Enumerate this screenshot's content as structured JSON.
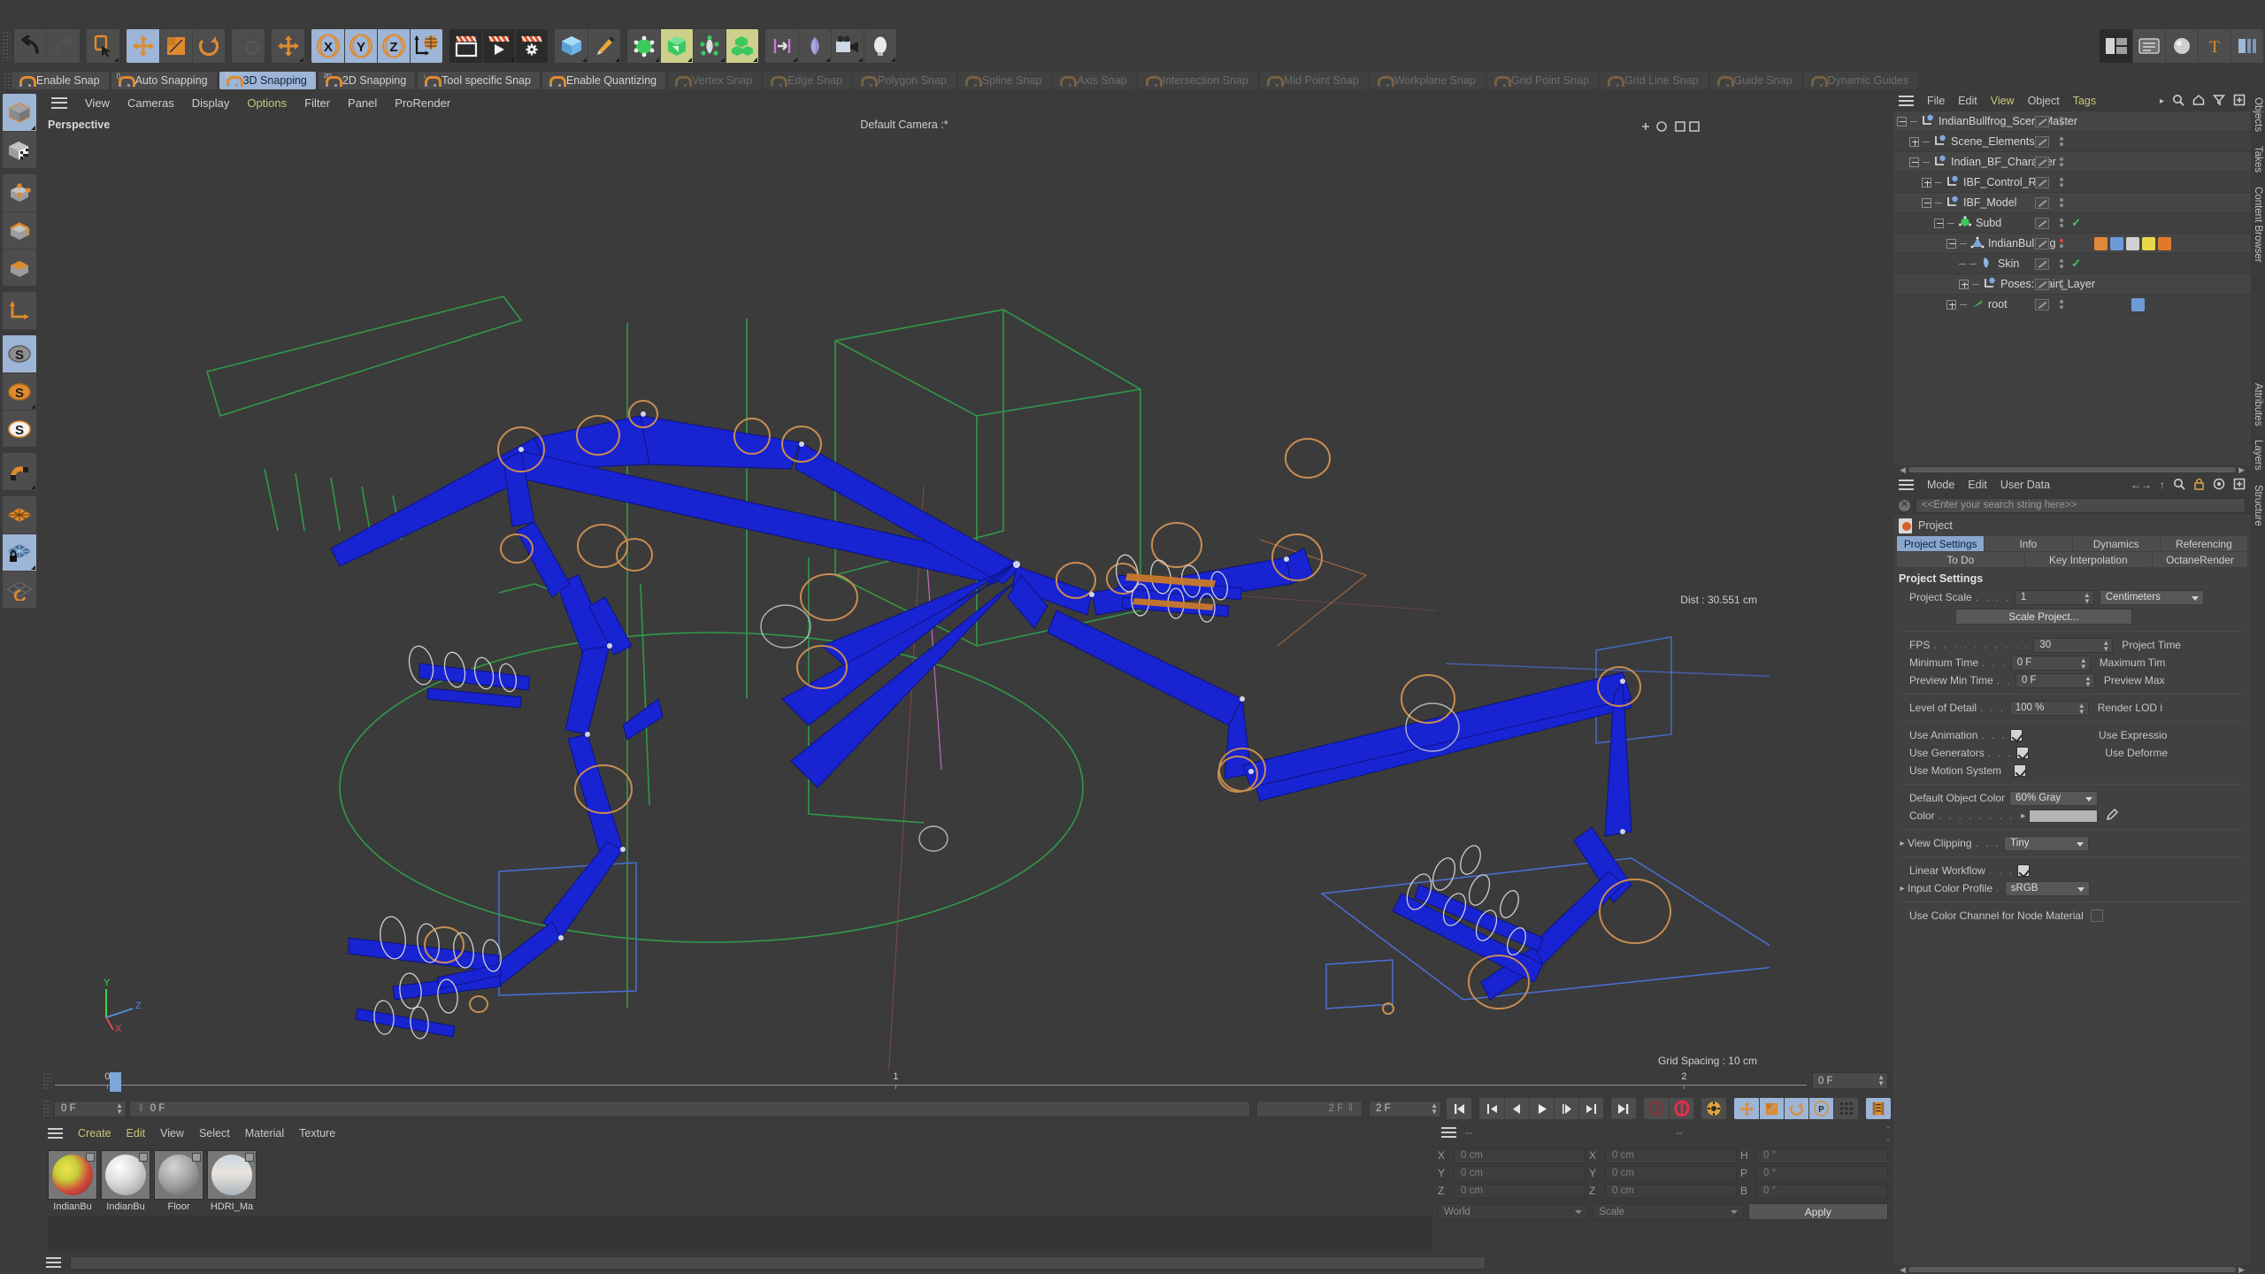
{
  "app": {
    "title": "Cinema 4D"
  },
  "main_toolbar": {
    "groups": [
      {
        "name": "history",
        "buttons": [
          {
            "id": "undo",
            "icon": "undo-arrow-icon",
            "state": "normal"
          },
          {
            "id": "redo",
            "icon": "redo-arrow-icon",
            "state": "disabled"
          }
        ]
      },
      {
        "name": "selection",
        "buttons": [
          {
            "id": "live-selection",
            "icon": "live-selection-icon",
            "state": "normal"
          }
        ]
      },
      {
        "name": "transform",
        "buttons": [
          {
            "id": "move",
            "icon": "move-icon",
            "state": "active"
          },
          {
            "id": "scale",
            "icon": "scale-icon",
            "state": "normal"
          },
          {
            "id": "rotate",
            "icon": "rotate-icon",
            "state": "normal"
          }
        ]
      },
      {
        "name": "psr",
        "buttons": [
          {
            "id": "psr-lock",
            "icon": "psr-rotate-icon",
            "state": "disabled"
          }
        ]
      },
      {
        "name": "world-move",
        "buttons": [
          {
            "id": "world-move",
            "icon": "move-icon",
            "state": "normal"
          }
        ]
      },
      {
        "name": "axes",
        "buttons": [
          {
            "id": "axis-x",
            "icon": "axis-x-icon",
            "state": "active",
            "label": "X"
          },
          {
            "id": "axis-y",
            "icon": "axis-y-icon",
            "state": "active",
            "label": "Y"
          },
          {
            "id": "axis-z",
            "icon": "axis-z-icon",
            "state": "active",
            "label": "Z"
          },
          {
            "id": "world-coordinates",
            "icon": "globe-axis-icon",
            "state": "active"
          }
        ]
      },
      {
        "name": "render",
        "buttons": [
          {
            "id": "render-view",
            "icon": "render-view-icon",
            "state": "dark"
          },
          {
            "id": "render-to-picture-viewer",
            "icon": "render-picture-viewer-icon",
            "state": "dark"
          },
          {
            "id": "render-settings",
            "icon": "render-settings-icon",
            "state": "dark"
          }
        ]
      },
      {
        "name": "primitives",
        "buttons": [
          {
            "id": "cube-primitive",
            "icon": "cube-icon",
            "state": "normal"
          },
          {
            "id": "pen-spline",
            "icon": "pen-icon",
            "state": "normal"
          }
        ]
      },
      {
        "name": "generators",
        "buttons": [
          {
            "id": "generators",
            "icon": "generator-icon",
            "state": "normal"
          },
          {
            "id": "array",
            "icon": "array-green-icon",
            "state": "olive"
          },
          {
            "id": "deformers",
            "icon": "deformer-icon",
            "state": "normal"
          },
          {
            "id": "mograph",
            "icon": "mograph-cubes-icon",
            "state": "olive"
          }
        ]
      },
      {
        "name": "misc",
        "buttons": [
          {
            "id": "scene-nodes",
            "icon": "scene-nodes-icon",
            "state": "normal"
          },
          {
            "id": "field",
            "icon": "field-icon",
            "state": "normal"
          },
          {
            "id": "camera",
            "icon": "camera-icon",
            "state": "normal"
          },
          {
            "id": "light",
            "icon": "light-bulb-icon",
            "state": "normal"
          }
        ]
      },
      {
        "name": "layout-right",
        "buttons": [
          {
            "id": "layout-switch",
            "icon": "layout-icon",
            "state": "dark"
          },
          {
            "id": "content-browser",
            "icon": "browser-icon",
            "state": "normal"
          },
          {
            "id": "material-sphere",
            "icon": "material-sphere-icon",
            "state": "normal"
          },
          {
            "id": "text-tool",
            "icon": "text-tool-icon",
            "state": "normal"
          },
          {
            "id": "more-tools",
            "icon": "more-tools-icon",
            "state": "normal"
          }
        ]
      }
    ]
  },
  "snap_bar": {
    "items": [
      {
        "label": "Enable Snap",
        "state": "on"
      },
      {
        "label": "Auto Snapping",
        "state": "on",
        "sup": "()"
      },
      {
        "label": "3D Snapping",
        "state": "selected",
        "sup": "3D"
      },
      {
        "label": "2D Snapping",
        "state": "on",
        "sup": "2D"
      },
      {
        "label": "Tool specific Snap",
        "state": "on",
        "sup": "↓"
      },
      {
        "label": "Enable Quantizing",
        "state": "on",
        "icon": "quantize-icon"
      },
      {
        "label": "Vertex Snap",
        "state": "off"
      },
      {
        "label": "Edge Snap",
        "state": "off"
      },
      {
        "label": "Polygon Snap",
        "state": "off"
      },
      {
        "label": "Spline Snap",
        "state": "off"
      },
      {
        "label": "Axis Snap",
        "state": "off"
      },
      {
        "label": "Intersection Snap",
        "state": "off"
      },
      {
        "label": "Mid Point Snap",
        "state": "off"
      },
      {
        "label": "Workplane Snap",
        "state": "off"
      },
      {
        "label": "Grid Point Snap",
        "state": "off"
      },
      {
        "label": "Grid Line Snap",
        "state": "off"
      },
      {
        "label": "Guide Snap",
        "state": "off"
      },
      {
        "label": "Dynamic Guides",
        "state": "off"
      }
    ]
  },
  "left_toolbar": {
    "groups": [
      {
        "buttons": [
          {
            "id": "model-mode",
            "icon": "model-cube-icon",
            "state": "active"
          },
          {
            "id": "texture-mode",
            "icon": "texture-cube-icon",
            "state": "normal"
          }
        ]
      },
      {
        "buttons": [
          {
            "id": "points-mode",
            "icon": "points-cube-icon",
            "state": "normal"
          },
          {
            "id": "edges-mode",
            "icon": "edges-cube-icon",
            "state": "normal"
          },
          {
            "id": "polygons-mode",
            "icon": "polygons-cube-icon",
            "state": "normal"
          }
        ]
      },
      {
        "buttons": [
          {
            "id": "object-axis-mode",
            "icon": "axis-corner-icon",
            "state": "normal"
          }
        ]
      },
      {
        "buttons": [
          {
            "id": "enable-axis",
            "icon": "s-grey-icon",
            "state": "active"
          },
          {
            "id": "soft-selection",
            "icon": "s-orange-icon",
            "state": "normal"
          },
          {
            "id": "soft-selection-2",
            "icon": "s-white-icon",
            "state": "normal"
          }
        ]
      },
      {
        "buttons": [
          {
            "id": "magnet-tool",
            "icon": "magnet-icon",
            "state": "normal"
          }
        ]
      },
      {
        "buttons": [
          {
            "id": "workplane",
            "icon": "workplane-icon",
            "state": "normal"
          },
          {
            "id": "lock-workplane",
            "icon": "workplane-lock-icon",
            "state": "active"
          },
          {
            "id": "align-workplane",
            "icon": "workplane-rotate-icon",
            "state": "normal"
          }
        ]
      }
    ]
  },
  "viewport": {
    "menu": [
      {
        "label": "View",
        "highlight": false
      },
      {
        "label": "Cameras",
        "highlight": false
      },
      {
        "label": "Display",
        "highlight": false
      },
      {
        "label": "Options",
        "highlight": true
      },
      {
        "label": "Filter",
        "highlight": false
      },
      {
        "label": "Panel",
        "highlight": false
      },
      {
        "label": "ProRender",
        "highlight": false
      }
    ],
    "label": "Perspective",
    "camera": "Default Camera :*",
    "distance": "Dist : 30.551 cm",
    "grid_spacing": "Grid Spacing : 10 cm",
    "axis_labels": {
      "x": "X",
      "y": "Y",
      "z": "Z"
    }
  },
  "object_manager": {
    "menu": [
      {
        "label": "File",
        "highlight": false
      },
      {
        "label": "Edit",
        "highlight": false
      },
      {
        "label": "View",
        "highlight": true
      },
      {
        "label": "Object",
        "highlight": false
      },
      {
        "label": "Tags",
        "highlight": true
      }
    ],
    "icons": [
      "search-icon",
      "home-icon",
      "filter-icon",
      "add-icon"
    ],
    "rows": [
      {
        "name": "IndianBullfrog_SceneMaster",
        "depth": 0,
        "expander": "minus",
        "icon": "null-object-icon",
        "tick": false,
        "tags": []
      },
      {
        "name": "Scene_Elements",
        "depth": 1,
        "expander": "plus",
        "icon": "null-object-icon",
        "tick": false,
        "tags": []
      },
      {
        "name": "Indian_BF_Character",
        "depth": 1,
        "expander": "minus",
        "icon": "null-object-icon",
        "tick": false,
        "tags": []
      },
      {
        "name": "IBF_Control_Rig",
        "depth": 2,
        "expander": "plus",
        "icon": "null-object-icon",
        "tick": false,
        "tags": []
      },
      {
        "name": "IBF_Model",
        "depth": 2,
        "expander": "minus",
        "icon": "null-object-icon",
        "tick": false,
        "tags": []
      },
      {
        "name": "Subd",
        "depth": 3,
        "expander": "minus",
        "icon": "subdivision-icon",
        "tick": true,
        "tags": []
      },
      {
        "name": "IndianBullfrog",
        "depth": 4,
        "expander": "minus",
        "icon": "polygon-object-icon",
        "tick": false,
        "dot": "red",
        "tags": [
          "point-cache-tag",
          "joint-tag",
          "material-grey-tag",
          "material-color-tag",
          "orange-tag"
        ]
      },
      {
        "name": "Skin",
        "depth": 5,
        "expander": "none",
        "icon": "skin-deformer-icon",
        "tick": true,
        "tags": []
      },
      {
        "name": "Poses: Main_Layer",
        "depth": 5,
        "expander": "plus",
        "icon": "null-object-icon",
        "tick": false,
        "tags": []
      },
      {
        "name": "root",
        "depth": 4,
        "expander": "plus",
        "icon": "joint-icon",
        "tick": false,
        "tags": [
          "joint-psr-tag"
        ]
      }
    ]
  },
  "attributes": {
    "menu": [
      {
        "label": "Mode",
        "highlight": false
      },
      {
        "label": "Edit",
        "highlight": false
      },
      {
        "label": "User Data",
        "highlight": false
      }
    ],
    "search_placeholder": "<<Enter your search string here>>",
    "object_name": "Project",
    "tabs": [
      {
        "label": "Project Settings",
        "selected": true
      },
      {
        "label": "Info",
        "selected": false
      },
      {
        "label": "Dynamics",
        "selected": false
      },
      {
        "label": "Referencing",
        "selected": false
      },
      {
        "label": "To Do",
        "selected": false
      },
      {
        "label": "Key Interpolation",
        "selected": false
      },
      {
        "label": "OctaneRender",
        "selected": false
      }
    ],
    "section_title": "Project Settings",
    "fields": {
      "project_scale_label": "Project Scale",
      "project_scale_value": "1",
      "project_scale_unit": "Centimeters",
      "scale_project_button": "Scale Project...",
      "fps_label": "FPS",
      "fps_value": "30",
      "project_time_label": "Project Time",
      "minimum_time_label": "Minimum Time",
      "minimum_time_value": "0 F",
      "maximum_time_label": "Maximum Tim",
      "preview_min_label": "Preview Min Time",
      "preview_min_value": "0 F",
      "preview_max_label": "Preview Max",
      "lod_label": "Level of Detail",
      "lod_value": "100 %",
      "render_lod_label": "Render LOD i",
      "use_animation_label": "Use Animation",
      "use_animation_checked": true,
      "use_expressions_label": "Use Expressio",
      "use_generators_label": "Use Generators",
      "use_generators_checked": true,
      "use_deformers_label": "Use Deforme",
      "use_motion_label": "Use Motion System",
      "use_motion_checked": true,
      "default_object_color_label": "Default Object Color",
      "default_object_color_value": "60% Gray",
      "color_label": "Color",
      "view_clipping_label": "View Clipping",
      "view_clipping_value": "Tiny",
      "linear_workflow_label": "Linear Workflow",
      "linear_workflow_checked": true,
      "input_color_profile_label": "Input Color Profile",
      "input_color_profile_value": "sRGB",
      "node_material_label": "Use Color Channel for Node Material",
      "node_material_checked": false
    }
  },
  "right_vtabs_top": [
    "Objects",
    "Takes",
    "Content Browser"
  ],
  "right_vtabs_bottom": [
    "Attributes",
    "Layers",
    "Structure"
  ],
  "timeline": {
    "start_marker": "0",
    "ticks": [
      {
        "label": "0",
        "pct": 3
      },
      {
        "label": "1",
        "pct": 48
      },
      {
        "label": "2",
        "pct": 93
      }
    ],
    "end_field": "0 F",
    "current_frame": "0 F",
    "current_frame_secondary": "0 F",
    "range_end": "2 F",
    "range_end_field": "2 F",
    "transport": [
      {
        "id": "go-to-start",
        "icon": "skip-start-icon"
      },
      {
        "id": "previous-keyframe",
        "icon": "prev-key-icon"
      },
      {
        "id": "step-back",
        "icon": "step-back-icon"
      },
      {
        "id": "play",
        "icon": "play-icon"
      },
      {
        "id": "step-forward",
        "icon": "step-forward-icon"
      },
      {
        "id": "next-keyframe",
        "icon": "next-key-icon"
      },
      {
        "id": "go-to-end",
        "icon": "skip-end-icon"
      }
    ],
    "record_buttons": [
      {
        "id": "autokey",
        "icon": "autokey-icon",
        "state": "dim"
      },
      {
        "id": "record",
        "icon": "record-icon",
        "state": "on"
      },
      {
        "id": "keyframe-selection",
        "icon": "key-selection-icon",
        "state": "on"
      }
    ],
    "key_toggles": [
      {
        "id": "key-position",
        "icon": "move-icon",
        "state": "active"
      },
      {
        "id": "key-scale",
        "icon": "scale-icon",
        "state": "active"
      },
      {
        "id": "key-rotation",
        "icon": "rotate-icon",
        "state": "active"
      },
      {
        "id": "key-param",
        "icon": "param-p-icon",
        "state": "active"
      },
      {
        "id": "key-points",
        "icon": "points-icon",
        "state": "normal"
      }
    ],
    "extra_buttons": [
      {
        "id": "timeline-film",
        "icon": "film-icon",
        "state": "active"
      }
    ]
  },
  "material_manager": {
    "menu": [
      {
        "label": "Create",
        "highlight": true
      },
      {
        "label": "Edit",
        "highlight": true
      },
      {
        "label": "View",
        "highlight": false
      },
      {
        "label": "Select",
        "highlight": false
      },
      {
        "label": "Material",
        "highlight": false
      },
      {
        "label": "Texture",
        "highlight": false
      }
    ],
    "materials": [
      {
        "name": "IndianBu",
        "type": "colorful"
      },
      {
        "name": "IndianBu",
        "type": "glossy"
      },
      {
        "name": "Floor",
        "type": "grey"
      },
      {
        "name": "HDRI_Ma",
        "type": "hdri"
      }
    ]
  },
  "coordinates": {
    "header_fields": [
      "--",
      "--",
      "--"
    ],
    "position": {
      "label_x": "X",
      "label_y": "Y",
      "label_z": "Z",
      "x": "0 cm",
      "y": "0 cm",
      "z": "0 cm"
    },
    "size": {
      "label_x": "X",
      "label_y": "Y",
      "label_z": "Z",
      "x": "0 cm",
      "y": "0 cm",
      "z": "0 cm"
    },
    "rotation": {
      "label_h": "H",
      "label_p": "P",
      "label_b": "B",
      "h": "0 °",
      "p": "0 °",
      "b": "0 °"
    },
    "system_dropdown": "World",
    "mode_dropdown": "Scale",
    "apply_button": "Apply"
  },
  "colors": {
    "panel_bg": "#3b3b3b",
    "panel_alt": "#414141",
    "button_bg": "#4d4d4d",
    "accent_blue": "#9db5d6",
    "accent_orange": "#e08a2e",
    "rig_blue": "#1823d2",
    "grid_green": "#2f9e4a",
    "text": "#c8c8c8",
    "menu_highlight": "#c8c87a"
  }
}
